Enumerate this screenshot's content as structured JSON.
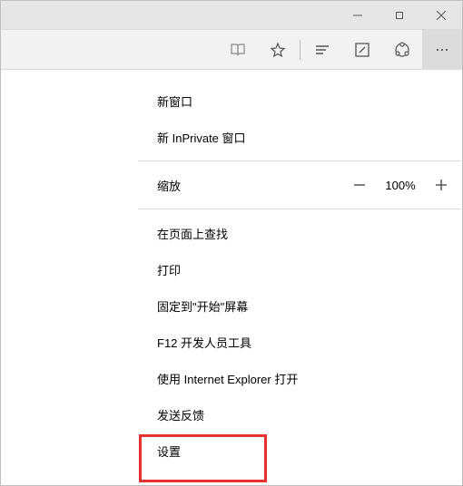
{
  "window": {
    "minimize_label": "minimize",
    "maximize_label": "maximize",
    "close_label": "close"
  },
  "toolbar": {
    "reading_list_label": "reading-list",
    "favorite_label": "favorite",
    "hub_label": "hub",
    "note_label": "web-note",
    "share_label": "share",
    "more_label": "more"
  },
  "menu": {
    "new_window": "新窗口",
    "new_inprivate": "新 InPrivate 窗口",
    "zoom_label": "缩放",
    "zoom_value": "100%",
    "find": "在页面上查找",
    "print": "打印",
    "pin_start": "固定到\"开始\"屏幕",
    "dev_tools": "F12 开发人员工具",
    "open_ie": "使用 Internet Explorer 打开",
    "feedback": "发送反馈",
    "settings": "设置"
  }
}
